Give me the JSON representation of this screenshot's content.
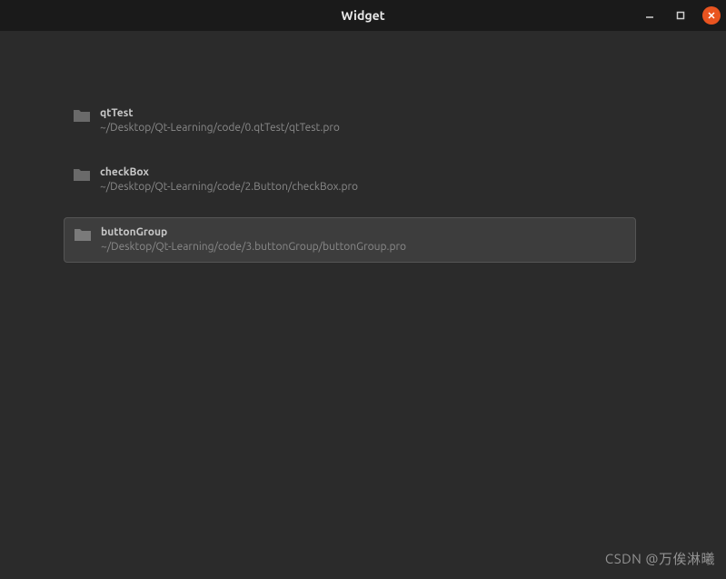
{
  "window": {
    "title": "Widget"
  },
  "projects": [
    {
      "name": "qtTest",
      "path": "~/Desktop/Qt-Learning/code/0.qtTest/qtTest.pro",
      "selected": false
    },
    {
      "name": "checkBox",
      "path": "~/Desktop/Qt-Learning/code/2.Button/checkBox.pro",
      "selected": false
    },
    {
      "name": "buttonGroup",
      "path": "~/Desktop/Qt-Learning/code/3.buttonGroup/buttonGroup.pro",
      "selected": true
    }
  ],
  "watermark": "CSDN @万俟淋曦"
}
